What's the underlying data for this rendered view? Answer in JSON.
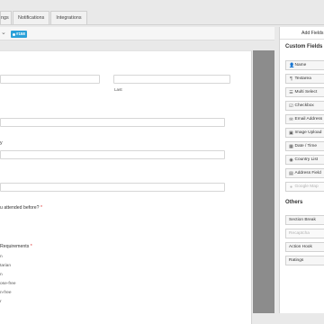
{
  "tabs": [
    {
      "label": "ngs"
    },
    {
      "label": "Notifications"
    },
    {
      "label": "Integrations"
    }
  ],
  "editor": {
    "form_id": "#158",
    "chevron": "chevron-down-icon"
  },
  "form": {
    "name_last_sublabel": "Last",
    "q_letter": "y",
    "attended_label": "u attended before?",
    "requirements_label": "Requirements",
    "required_mark": "*",
    "options": [
      "n",
      "tarian",
      "n",
      "ose-free",
      "n-free",
      "r"
    ]
  },
  "panel": {
    "tab_label": "Add Fields",
    "custom_fields_title": "Custom Fields",
    "custom_fields": [
      {
        "label": "Name",
        "icon": "person-icon",
        "glyph": "👤",
        "disabled": false
      },
      {
        "label": "Textarea",
        "icon": "paragraph-icon",
        "glyph": "¶",
        "disabled": false
      },
      {
        "label": "Multi Select",
        "icon": "list-icon",
        "glyph": "☰",
        "disabled": false
      },
      {
        "label": "Checkbox",
        "icon": "checkbox-icon",
        "glyph": "☑",
        "disabled": false
      },
      {
        "label": "Email Address",
        "icon": "envelope-icon",
        "glyph": "✉",
        "disabled": false
      },
      {
        "label": "Image Upload",
        "icon": "image-icon",
        "glyph": "▣",
        "disabled": false
      },
      {
        "label": "Date / Time",
        "icon": "calendar-icon",
        "glyph": "▦",
        "disabled": false
      },
      {
        "label": "Country List",
        "icon": "globe-icon",
        "glyph": "◉",
        "disabled": false
      },
      {
        "label": "Address Field",
        "icon": "address-icon",
        "glyph": "▤",
        "disabled": false
      },
      {
        "label": "Google Map",
        "icon": "map-pin-icon",
        "glyph": "●",
        "disabled": true
      }
    ],
    "others_title": "Others",
    "others": [
      {
        "label": "Section Break",
        "disabled": false
      },
      {
        "label": "Recaptcha",
        "disabled": true
      },
      {
        "label": "Action Hook",
        "disabled": false
      },
      {
        "label": "Ratings",
        "disabled": false
      }
    ]
  }
}
